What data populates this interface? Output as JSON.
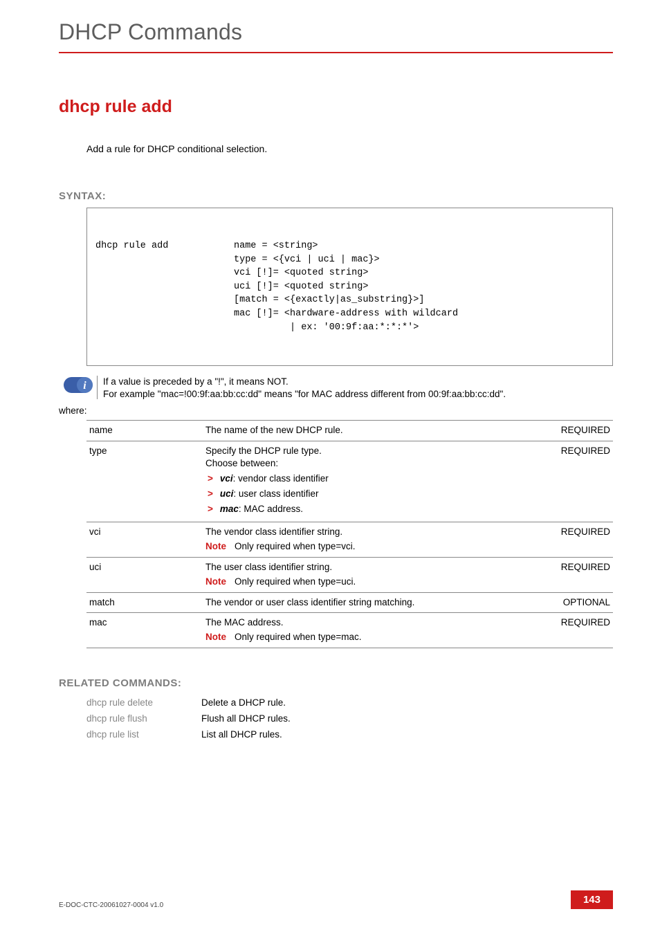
{
  "header": {
    "title": "DHCP Commands"
  },
  "cmd": {
    "title": "dhcp rule add",
    "intro": "Add a rule for DHCP conditional selection."
  },
  "syntax": {
    "heading": "SYNTAX:",
    "command": "dhcp rule add",
    "args": "name = <string>\ntype = <{vci | uci | mac}>\nvci [!]= <quoted string>\nuci [!]= <quoted string>\n[match = <{exactly|as_substring}>]\nmac [!]= <hardware-address with wildcard\n          | ex: '00:9f:aa:*:*:*'>"
  },
  "callout": {
    "line1": "If a value is preceded by a \"!\", it means NOT.",
    "line2": "For example \"mac=!00:9f:aa:bb:cc:dd\" means \"for MAC address different from 00:9f:aa:bb:cc:dd\"."
  },
  "where_label": "where:",
  "params": {
    "note_label": "Note",
    "rows": [
      {
        "name": "name",
        "desc": "The name of the new DHCP  rule.",
        "req": "REQUIRED"
      },
      {
        "name": "type",
        "desc": "Specify the DHCP  rule type.\nChoose between:",
        "bullets": [
          {
            "em": "vci",
            "text": ": vendor class identifier"
          },
          {
            "em": "uci",
            "text": ": user class identifier"
          },
          {
            "em": "mac",
            "text": ": MAC address."
          }
        ],
        "req": "REQUIRED"
      },
      {
        "name": "vci",
        "desc": "The vendor class identifier string.",
        "note": "Only required when type=vci.",
        "req": "REQUIRED"
      },
      {
        "name": "uci",
        "desc": "The user class identifier string.",
        "note": "Only required when type=uci.",
        "req": "REQUIRED"
      },
      {
        "name": "match",
        "desc": "The vendor or user class identifier string matching.",
        "req": "OPTIONAL"
      },
      {
        "name": "mac",
        "desc": "The MAC address.",
        "note": "Only required when type=mac.",
        "req": "REQUIRED"
      }
    ]
  },
  "related": {
    "heading": "RELATED COMMANDS:",
    "items": [
      {
        "cmd": "dhcp rule delete",
        "desc": "Delete a DHCP rule."
      },
      {
        "cmd": "dhcp rule flush",
        "desc": "Flush all DHCP rules."
      },
      {
        "cmd": "dhcp rule list",
        "desc": "List all DHCP rules."
      }
    ]
  },
  "footer": {
    "docid": "E-DOC-CTC-20061027-0004 v1.0",
    "page": "143"
  }
}
